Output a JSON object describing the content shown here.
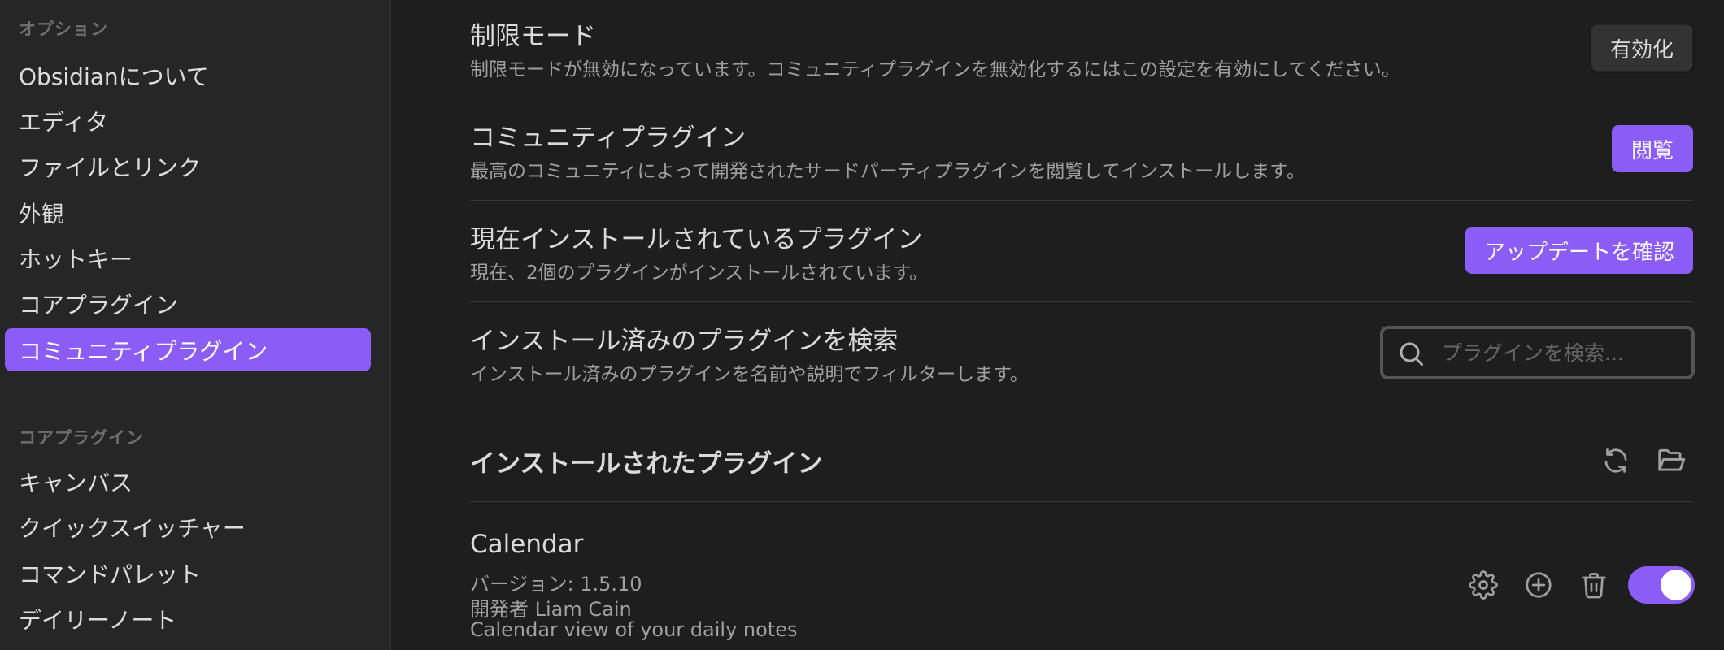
{
  "sidebar": {
    "options_label": "オプション",
    "options_items": [
      {
        "label": "Obsidianについて"
      },
      {
        "label": "エディタ"
      },
      {
        "label": "ファイルとリンク"
      },
      {
        "label": "外観"
      },
      {
        "label": "ホットキー"
      },
      {
        "label": "コアプラグイン"
      },
      {
        "label": "コミュニティプラグイン",
        "active": true
      }
    ],
    "core_label": "コアプラグイン",
    "core_items": [
      {
        "label": "キャンバス"
      },
      {
        "label": "クイックスイッチャー"
      },
      {
        "label": "コマンドパレット"
      },
      {
        "label": "デイリーノート"
      }
    ]
  },
  "settings": {
    "restricted": {
      "title": "制限モード",
      "desc": "制限モードが無効になっています。コミュニティプラグインを無効化するにはこの設定を有効にしてください。",
      "button": "有効化"
    },
    "community": {
      "title": "コミュニティプラグイン",
      "desc": "最高のコミュニティによって開発されたサードパーティプラグインを閲覧してインストールします。",
      "button": "閲覧"
    },
    "installed": {
      "title": "現在インストールされているプラグイン",
      "desc": "現在、2個のプラグインがインストールされています。",
      "button": "アップデートを確認"
    },
    "search": {
      "title": "インストール済みのプラグインを検索",
      "desc": "インストール済みのプラグインを名前や説明でフィルターします。",
      "placeholder": "プラグインを検索...",
      "value": ""
    }
  },
  "installed_plugins": {
    "heading": "インストールされたプラグイン",
    "icons": [
      "refresh-icon",
      "folder-open-icon"
    ],
    "plugins": [
      {
        "name": "Calendar",
        "version": "バージョン: 1.5.10",
        "author": "開発者 Liam Cain",
        "description": "Calendar view of your daily notes",
        "enabled": true,
        "icons": [
          "gear-icon",
          "plus-circle-icon",
          "trash-icon"
        ]
      }
    ]
  },
  "colors": {
    "accent": "#8b5cf6",
    "background": "#1e1e1e",
    "sidebar_background": "#262626"
  }
}
